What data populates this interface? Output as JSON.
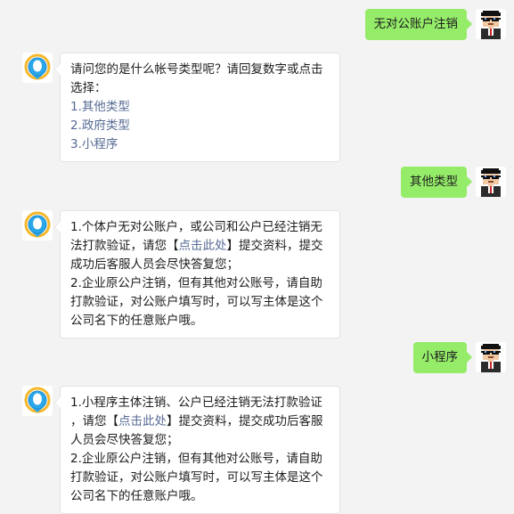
{
  "colors": {
    "page_background": "#f3f3f3",
    "user_bubble": "#95ec69",
    "bot_bubble": "#ffffff",
    "link": "#576b95"
  },
  "messages": [
    {
      "sender": "user",
      "text": "无对公账户注销",
      "avatar_icon": "pixel-man-sunglasses-avatar"
    },
    {
      "sender": "bot",
      "avatar_icon": "qq-penguin-avatar",
      "prompt_line1": "请问您的是什么帐号类型呢？请回复数字或点击",
      "prompt_line2": "选择：",
      "options": [
        "1.其他类型",
        "2.政府类型",
        "3.小程序"
      ]
    },
    {
      "sender": "user",
      "text": "其他类型",
      "avatar_icon": "pixel-man-sunglasses-avatar"
    },
    {
      "sender": "bot",
      "avatar_icon": "qq-penguin-avatar",
      "p1_line1": "1.个体户无对公账户，或公司和公户已经注销无",
      "p1_line2_pre": "法打款验证，请您【",
      "p1_link": "点击此处",
      "p1_line2_post": "】提交资料，提交",
      "p1_line3": "成功后客服人员会尽快答复您；",
      "p2_line1": "2.企业原公户注销，但有其他对公账号，请自助",
      "p2_line2": "打款验证，对公账户填写时，可以写主体是这个",
      "p2_line3": "公司名下的任意账户哦。"
    },
    {
      "sender": "user",
      "text": "小程序",
      "avatar_icon": "pixel-man-sunglasses-avatar"
    },
    {
      "sender": "bot",
      "avatar_icon": "qq-penguin-avatar",
      "p1_line1": "1.小程序主体注销、公户已经注销无法打款验证",
      "p1_line2_pre": "，请您【",
      "p1_link": "点击此处",
      "p1_line2_post": "】提交资料，提交成功后客服",
      "p1_line3": "人员会尽快答复您；",
      "p2_line1": "2.企业原公户注销，但有其他对公账号，请自助",
      "p2_line2": "打款验证，对公账户填写时，可以写主体是这个",
      "p2_line3": "公司名下的任意账户哦。"
    }
  ]
}
